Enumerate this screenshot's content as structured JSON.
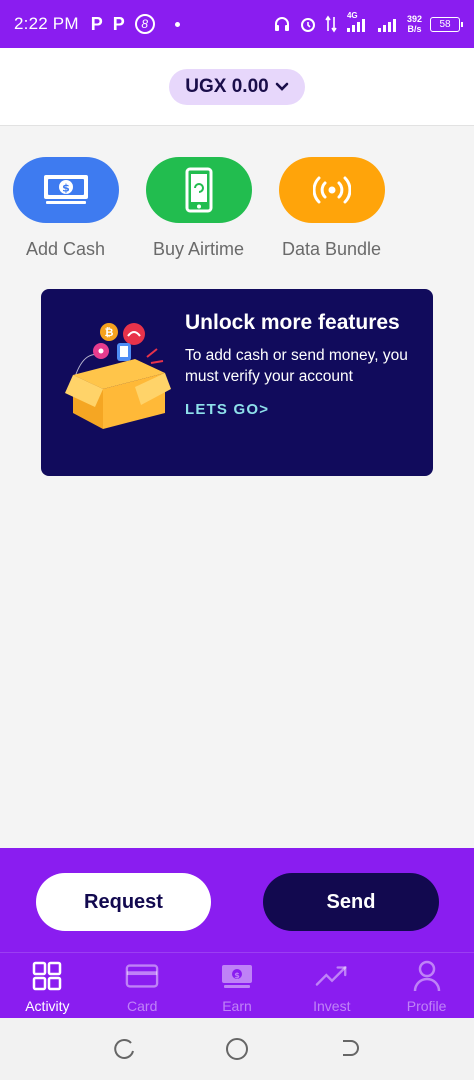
{
  "status_bar": {
    "time": "2:22 PM",
    "notif_p1": "P",
    "notif_p2": "P",
    "notif_b": "8",
    "network_label": "4G",
    "speed_value": "392",
    "speed_unit": "B/s",
    "battery": "58"
  },
  "header": {
    "currency_label": "UGX 0.00"
  },
  "actions": [
    {
      "label": "Add Cash",
      "color": "#3e7bf0",
      "icon": "cash-icon"
    },
    {
      "label": "Buy Airtime",
      "color": "#22bd4f",
      "icon": "phone-icon"
    },
    {
      "label": "Data Bundle",
      "color": "#ffa40a",
      "icon": "broadcast-icon"
    }
  ],
  "promo": {
    "title": "Unlock more features",
    "body": "To add cash or send money, you must verify your account",
    "link": "LETS GO>"
  },
  "buttons": {
    "request": "Request",
    "send": "Send"
  },
  "bottom_nav": [
    {
      "label": "Activity",
      "icon": "grid-icon",
      "active": true
    },
    {
      "label": "Card",
      "icon": "card-icon",
      "active": false
    },
    {
      "label": "Earn",
      "icon": "money-icon",
      "active": false
    },
    {
      "label": "Invest",
      "icon": "trend-icon",
      "active": false
    },
    {
      "label": "Profile",
      "icon": "person-icon",
      "active": false
    }
  ],
  "colors": {
    "brand_purple": "#8a1df0",
    "navy": "#12094f",
    "promo_bg": "#110b5c",
    "link": "#8ee0ea"
  }
}
